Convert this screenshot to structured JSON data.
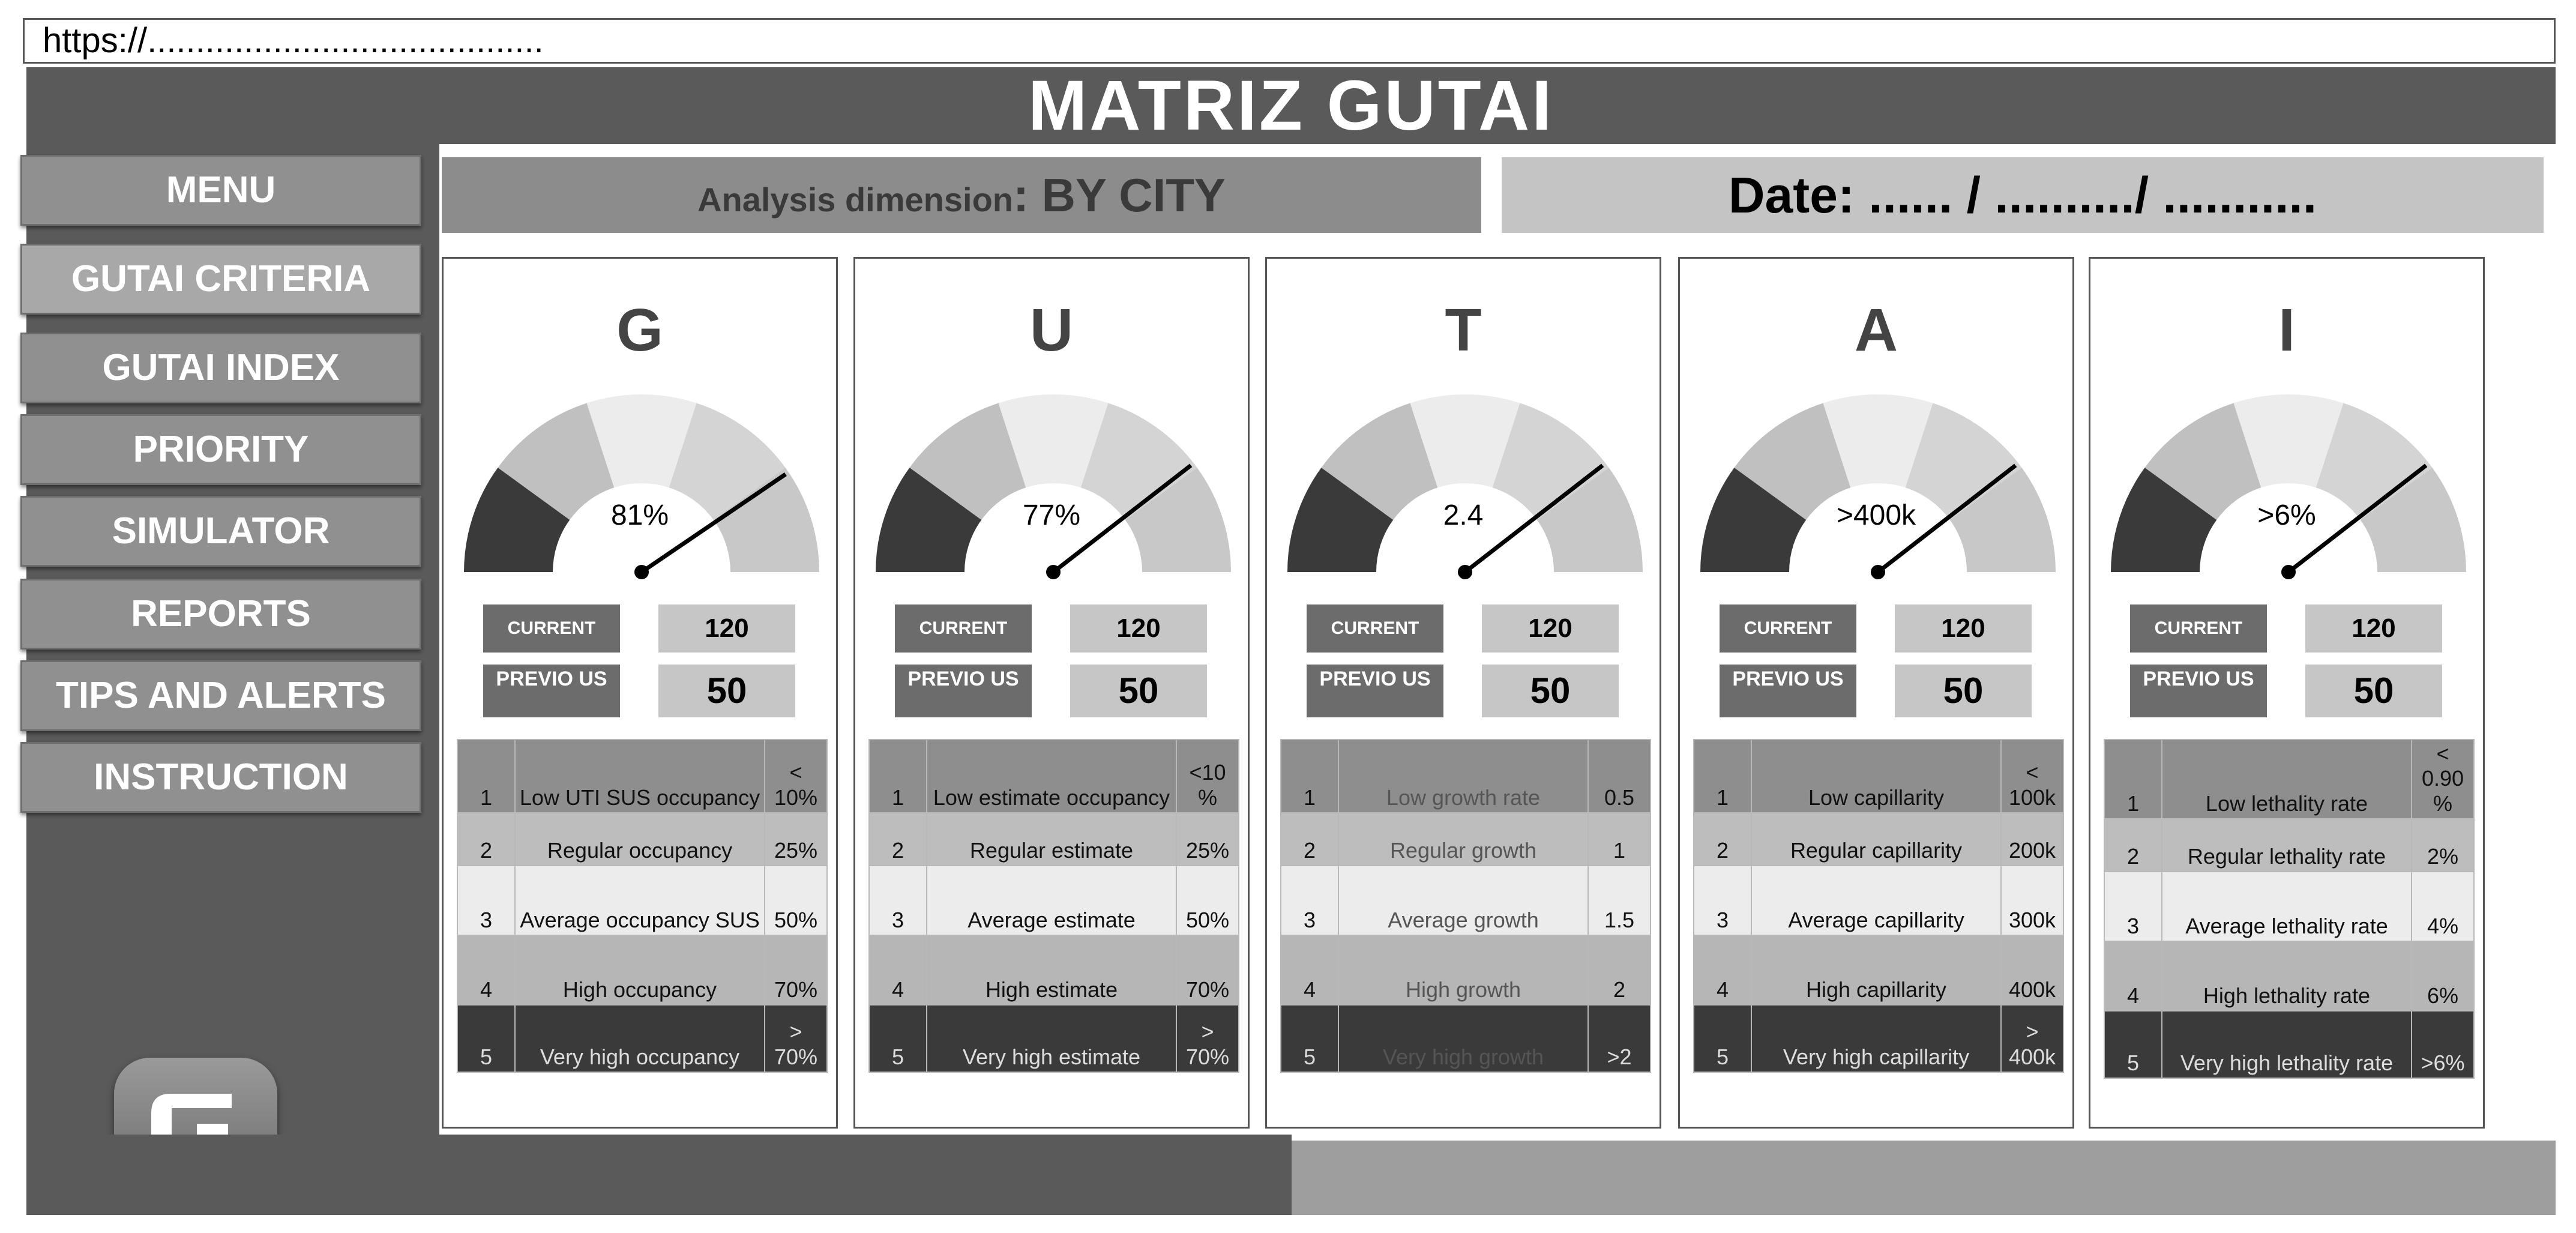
{
  "url": "https://.........................................",
  "app_title": "MATRIZ GUTAI",
  "menu": [
    {
      "label": "MENU"
    },
    {
      "label": "GUTAI CRITERIA"
    },
    {
      "label": "GUTAI INDEX"
    },
    {
      "label": "PRIORITY"
    },
    {
      "label": "SIMULATOR"
    },
    {
      "label": "REPORTS"
    },
    {
      "label": "TIPS AND ALERTS"
    },
    {
      "label": "INSTRUCTION"
    }
  ],
  "analysis": {
    "label": "Analysis dimension",
    "value": ": BY CITY"
  },
  "date_text": "Date: ...... / ........../ ...........",
  "colors": {
    "dark": "#5a5a5a",
    "gauge_dark": "#3a3a3a",
    "gauge_mid": "#c0c0c0",
    "gauge_light": "#ececec",
    "gauge_light2": "#d4d4d4",
    "gauge_edge": "#c8c8c8"
  },
  "cards": [
    {
      "letter": "G",
      "gauge_value": "81%",
      "gauge_level": 0.81,
      "current_label": "CURRENT",
      "current_value": "120",
      "previous_label": "PREVIO US",
      "previous_value": "50",
      "rows": [
        {
          "n": "1",
          "desc": "Low UTI SUS occupancy",
          "limit": "< 10%"
        },
        {
          "n": "2",
          "desc": "Regular occupancy",
          "limit": "25%"
        },
        {
          "n": "3",
          "desc": "Average occupancy SUS",
          "limit": "50%"
        },
        {
          "n": "4",
          "desc": "High occupancy",
          "limit": "70%"
        },
        {
          "n": "5",
          "desc": "Very high occupancy",
          "limit": "> 70%"
        }
      ]
    },
    {
      "letter": "U",
      "gauge_value": "77%",
      "gauge_level": 0.79,
      "current_label": "CURRENT",
      "current_value": "120",
      "previous_label": "PREVIO US",
      "previous_value": "50",
      "rows": [
        {
          "n": "1",
          "desc": "Low estimate occupancy",
          "limit": "<10 %"
        },
        {
          "n": "2",
          "desc": "Regular estimate",
          "limit": "25%"
        },
        {
          "n": "3",
          "desc": "Average estimate",
          "limit": "50%"
        },
        {
          "n": "4",
          "desc": "High estimate",
          "limit": "70%"
        },
        {
          "n": "5",
          "desc": "Very high estimate",
          "limit": "> 70%"
        }
      ]
    },
    {
      "letter": "T",
      "gauge_value": "2.4",
      "gauge_level": 0.79,
      "current_label": "CURRENT",
      "current_value": "120",
      "previous_label": "PREVIO US",
      "previous_value": "50",
      "rows": [
        {
          "n": "1",
          "desc": "Low growth rate",
          "limit": "0.5"
        },
        {
          "n": "2",
          "desc": "Regular growth",
          "limit": "1"
        },
        {
          "n": "3",
          "desc": "Average growth",
          "limit": "1.5"
        },
        {
          "n": "4",
          "desc": "High growth",
          "limit": "2"
        },
        {
          "n": "5",
          "desc": "Very high growth",
          "limit": ">2"
        }
      ]
    },
    {
      "letter": "A",
      "gauge_value": ">400k",
      "gauge_level": 0.79,
      "current_label": "CURRENT",
      "current_value": "120",
      "previous_label": "PREVIO US",
      "previous_value": "50",
      "rows": [
        {
          "n": "1",
          "desc": "Low capillarity",
          "limit": "< 100k"
        },
        {
          "n": "2",
          "desc": "Regular capillarity",
          "limit": "200k"
        },
        {
          "n": "3",
          "desc": "Average capillarity",
          "limit": "300k"
        },
        {
          "n": "4",
          "desc": "High capillarity",
          "limit": "400k"
        },
        {
          "n": "5",
          "desc": "Very high capillarity",
          "limit": "> 400k"
        }
      ]
    },
    {
      "letter": "I",
      "gauge_value": ">6%",
      "gauge_level": 0.79,
      "current_label": "CURRENT",
      "current_value": "120",
      "previous_label": "PREVIO US",
      "previous_value": "50",
      "rows": [
        {
          "n": "1",
          "desc": "Low lethality rate",
          "limit": "< 0.90 %"
        },
        {
          "n": "2",
          "desc": "Regular lethality rate",
          "limit": "2%"
        },
        {
          "n": "3",
          "desc": "Average lethality rate",
          "limit": "4%"
        },
        {
          "n": "4",
          "desc": "High lethality rate",
          "limit": "6%"
        },
        {
          "n": "5",
          "desc": "Very high lethality rate",
          "limit": ">6%"
        }
      ]
    }
  ]
}
